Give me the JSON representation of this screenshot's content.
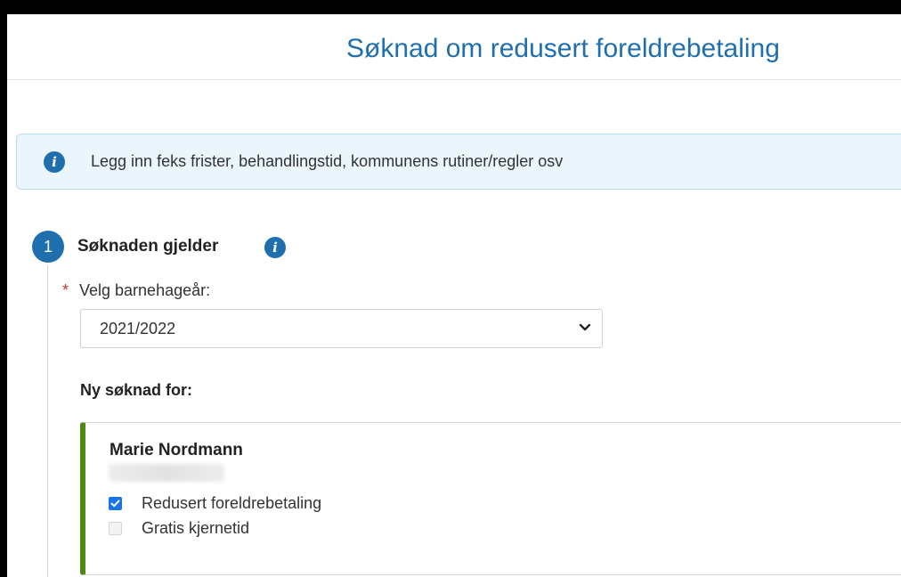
{
  "header": {
    "title": "Søknad om redusert foreldrebetaling"
  },
  "info_banner": {
    "icon": "info-icon",
    "text": "Legg inn feks frister, behandlingstid, kommunens rutiner/regler osv"
  },
  "step1": {
    "number": "1",
    "title": "Søknaden gjelder",
    "info_icon": "info-icon",
    "year_field": {
      "required_marker": "*",
      "label": "Velg barnehageår:",
      "selected_value": "2021/2022"
    },
    "subheading": "Ny søknad for:",
    "child": {
      "name": "Marie Nordmann",
      "options": [
        {
          "label": "Redusert foreldrebetaling",
          "checked": true,
          "disabled": false
        },
        {
          "label": "Gratis kjernetid",
          "checked": false,
          "disabled": true
        }
      ]
    }
  },
  "colors": {
    "brand_blue": "#1f6fae",
    "banner_bg": "#eaf5fc",
    "card_accent_green": "#4e8a12",
    "checkbox_blue": "#1a73e8",
    "required_red": "#c0392b"
  }
}
